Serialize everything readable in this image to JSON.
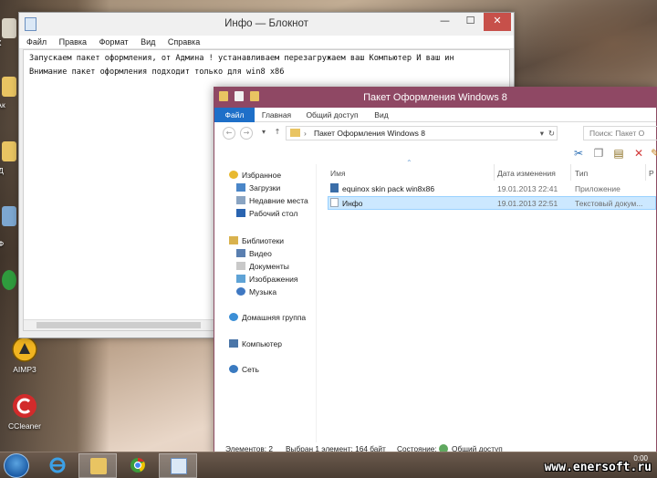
{
  "desktop": {
    "icons": [
      {
        "label": "AIMP3"
      },
      {
        "label": "CCleaner"
      }
    ],
    "edge_labels": [
      "К",
      "Ак",
      "Д",
      "Ф"
    ]
  },
  "notepad": {
    "title": "Инфо — Блокнот",
    "minimize_glyph": "—",
    "maximize_glyph": "☐",
    "close_glyph": "✕",
    "menu": [
      "Файл",
      "Правка",
      "Формат",
      "Вид",
      "Справка"
    ],
    "line1": "Запускаем пакет оформления, от Админа ! устанавливаем перезагружаем ваш Компьютер И ваш ин",
    "line2": "Внимание пакет оформления подходит только для win8 x86"
  },
  "explorer": {
    "title": "Пакет Оформления Windows 8",
    "ribbon_tabs": [
      "Файл",
      "Главная",
      "Общий доступ",
      "Вид"
    ],
    "address": "Пакет Оформления Windows 8",
    "search_placeholder": "Поиск: Пакет О",
    "nav": {
      "favorites": "Избранное",
      "downloads": "Загрузки",
      "recent": "Недавние места",
      "desktop": "Рабочий стол",
      "libraries": "Библиотеки",
      "video": "Видео",
      "documents": "Документы",
      "images": "Изображения",
      "music": "Музыка",
      "homegroup": "Домашняя группа",
      "computer": "Компьютер",
      "network": "Сеть"
    },
    "columns": {
      "name": "Имя",
      "date": "Дата изменения",
      "type": "Тип",
      "size": "Р"
    },
    "files": [
      {
        "name": "equinox skin pack win8x86",
        "date": "19.01.2013 22:41",
        "type": "Приложение",
        "selected": false
      },
      {
        "name": "Инфо",
        "date": "19.01.2013 22:51",
        "type": "Текстовый докум...",
        "selected": true
      }
    ],
    "status": {
      "count": "Элементов: 2",
      "selection": "Выбран 1 элемент: 164 байт",
      "state": "Состояние:",
      "shared": "Общий доступ"
    }
  },
  "taskbar": {
    "clock": "0:00"
  },
  "watermark": "www.enersoft.ru"
}
